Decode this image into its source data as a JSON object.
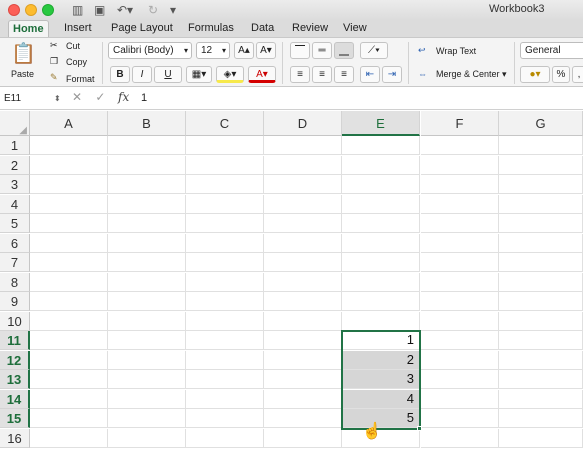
{
  "window": {
    "title": "Workbook3"
  },
  "tabs": [
    "Home",
    "Insert",
    "Page Layout",
    "Formulas",
    "Data",
    "Review",
    "View"
  ],
  "ribbon": {
    "paste_label": "Paste",
    "cut_label": "Cut",
    "copy_label": "Copy",
    "format_label": "Format",
    "font_name": "Calibri (Body)",
    "font_size": "12",
    "bold": "B",
    "italic": "I",
    "underline": "U",
    "wrap_text": "Wrap Text",
    "merge_center": "Merge & Center",
    "number_format": "General",
    "percent": "%"
  },
  "formula_bar": {
    "cell_ref": "E11",
    "fx": "fx",
    "value": "1"
  },
  "columns": [
    "A",
    "B",
    "C",
    "D",
    "E",
    "F",
    "G"
  ],
  "rows": [
    "1",
    "2",
    "3",
    "4",
    "5",
    "6",
    "7",
    "8",
    "9",
    "10",
    "11",
    "12",
    "13",
    "14",
    "15",
    "16"
  ],
  "cells": {
    "E11": "1",
    "E12": "2",
    "E13": "3",
    "E14": "4",
    "E15": "5"
  },
  "colors": {
    "accent": "#217346",
    "selection_fill": "#d6d6d6"
  }
}
